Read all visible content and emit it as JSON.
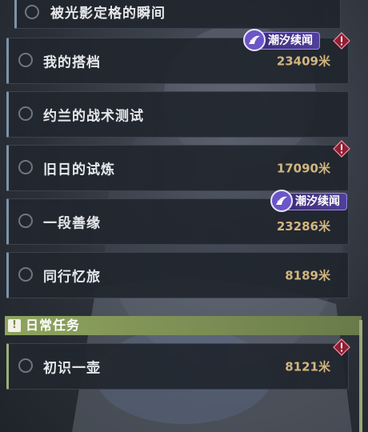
{
  "quests": [
    {
      "title": "被光影定格的瞬间",
      "distance": ""
    },
    {
      "title": "我的搭档",
      "distance": "23409米",
      "badge": "潮汐续闻",
      "alert": true
    },
    {
      "title": "约兰的战术测试",
      "distance": ""
    },
    {
      "title": "旧日的试炼",
      "distance": "17090米",
      "alert": true
    },
    {
      "title": "一段善缘",
      "distance": "23286米",
      "badge": "潮汐续闻"
    },
    {
      "title": "同行忆旅",
      "distance": "8189米"
    }
  ],
  "daily_section": {
    "icon": "exclamation-icon",
    "label": "日常任务",
    "items": [
      {
        "title": "初识一壶",
        "distance": "8121米",
        "alert": true
      }
    ]
  },
  "colors": {
    "distance": "#d2b67e",
    "badge_bg": "#51409a",
    "section_bg": "#8fa45f",
    "alert": "#c0304a"
  }
}
